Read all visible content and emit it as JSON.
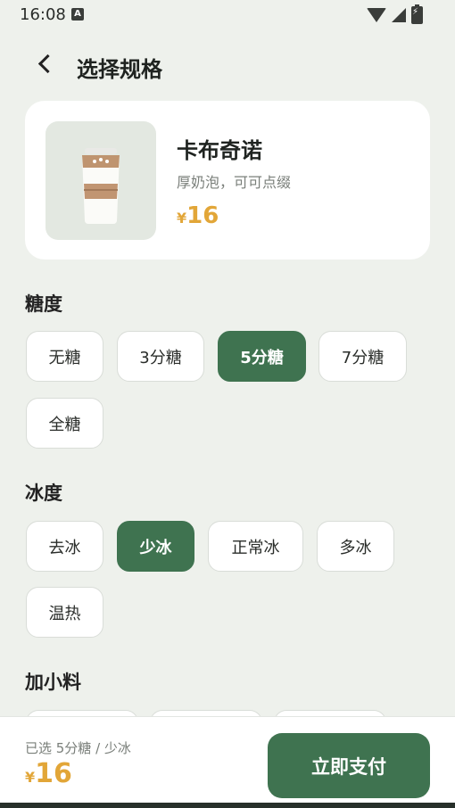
{
  "status": {
    "time": "16:08",
    "a_icon": "A"
  },
  "header": {
    "title": "选择规格"
  },
  "product": {
    "name": "卡布奇诺",
    "desc": "厚奶泡，可可点缀",
    "price_symbol": "¥",
    "price": "16"
  },
  "sections": {
    "sugar": {
      "title": "糖度",
      "options": [
        "无糖",
        "3分糖",
        "5分糖",
        "7分糖",
        "全糖"
      ],
      "selected": "5分糖"
    },
    "ice": {
      "title": "冰度",
      "options": [
        "去冰",
        "少冰",
        "正常冰",
        "多冰",
        "温热"
      ],
      "selected": "少冰"
    },
    "toppings": {
      "title": "加小料"
    }
  },
  "summary": {
    "selected_text": "已选 5分糖 / 少冰",
    "price_symbol": "¥",
    "price": "16",
    "pay_label": "立即支付"
  },
  "colors": {
    "accent": "#3f7350",
    "price": "#e2a638",
    "background": "#eef1ec"
  }
}
